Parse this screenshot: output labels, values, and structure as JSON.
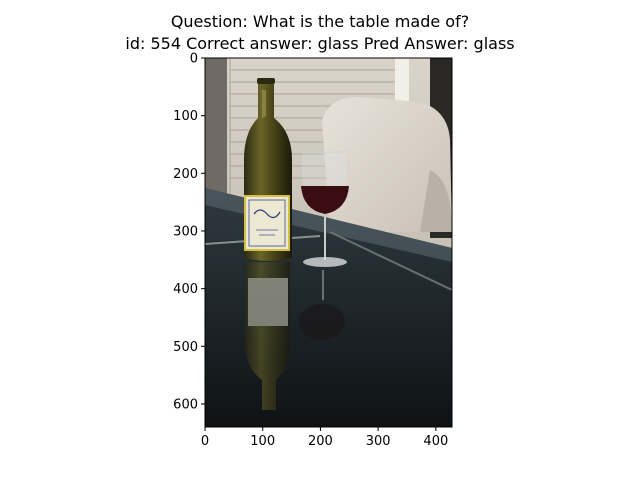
{
  "figure": {
    "title_line1": "Question: What is the table made of?",
    "title_line2": "id: 554 Correct answer: glass Pred Answer: glass"
  },
  "chart_data": {
    "type": "image",
    "image_content": "photo: wine bottle with label and glass of red wine on a glass patio table, cushioned chair and siding in background",
    "xlim": [
      0,
      428
    ],
    "ylim": [
      640,
      0
    ],
    "xticks": [
      0,
      100,
      200,
      300,
      400
    ],
    "yticks": [
      0,
      100,
      200,
      300,
      400,
      500,
      600
    ],
    "xlabel": "",
    "ylabel": "",
    "grid": false
  }
}
